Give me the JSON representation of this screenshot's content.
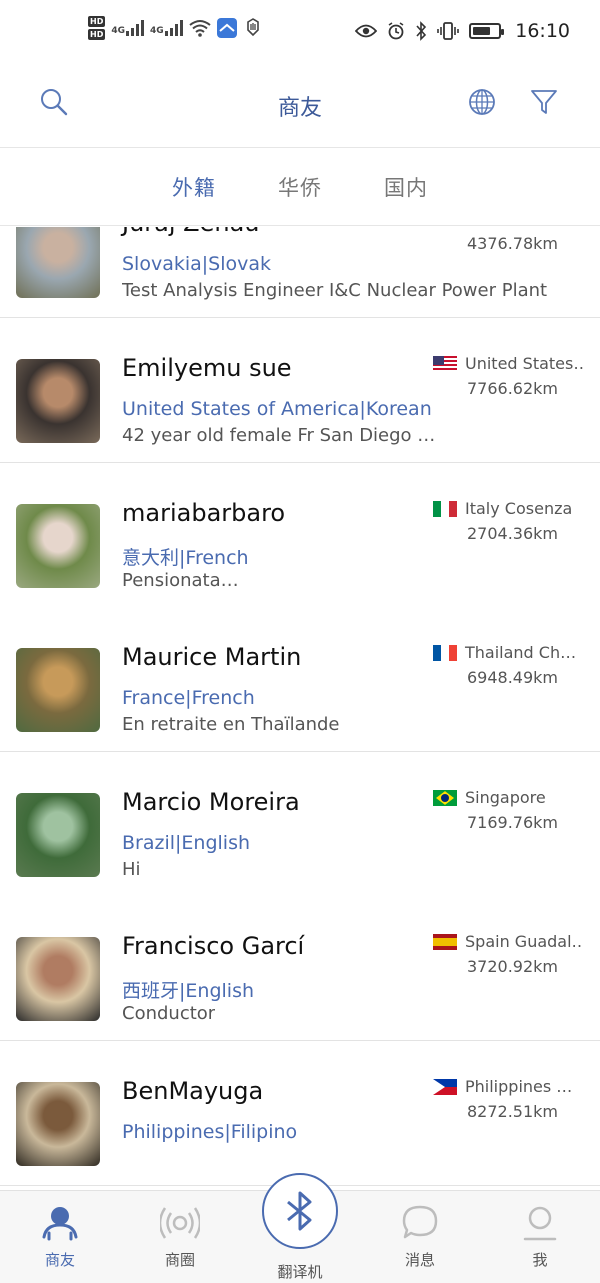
{
  "status_bar": {
    "hd1": "HD",
    "hd2": "HD",
    "net1": "4G",
    "net2": "4G",
    "time": "16:10",
    "battery_level": 0.7
  },
  "header": {
    "title": "商友",
    "search_icon": "search-icon",
    "globe_icon": "globe-icon",
    "filter_icon": "filter-icon"
  },
  "tabs": [
    {
      "label": "外籍",
      "active": true
    },
    {
      "label": "华侨",
      "active": false
    },
    {
      "label": "国内",
      "active": false
    }
  ],
  "contacts": [
    {
      "name": "Juraj Zenau",
      "origin": "Slovakia|Slovak",
      "bio": "Test Analysis Engineer I&C Nuclear Power Plant",
      "location": "",
      "distance": "4376.78km",
      "flag": "",
      "avatar_colors": [
        "#9aa7b0",
        "#c9b1a0",
        "#6f6f55"
      ]
    },
    {
      "name": "Emilyemu sue",
      "origin": "United States of America|Korean",
      "bio": " 42 year old female Fr San Diego …",
      "location": "United States…",
      "distance": "7766.62km",
      "flag": "us",
      "avatar_colors": [
        "#3a3330",
        "#b78a6a",
        "#7a6a5a"
      ]
    },
    {
      "name": "mariabarbaro",
      "origin": "意大利|French",
      "bio": "Pensionata…",
      "location": "Italy Cosenza",
      "distance": "2704.36km",
      "flag": "it",
      "avatar_colors": [
        "#6f8a4a",
        "#e6d6cc",
        "#9aa880"
      ]
    },
    {
      "name": "Maurice Martin",
      "origin": "France|French",
      "bio": "En retraite en Thaïlande",
      "location": "Thailand  Ch…",
      "distance": "6948.49km",
      "flag": "fr",
      "avatar_colors": [
        "#7b6a3f",
        "#c79a5a",
        "#4f6a40"
      ]
    },
    {
      "name": "Marcio Moreira",
      "origin": "Brazil|English",
      "bio": "Hi",
      "location": "Singapore",
      "distance": "7169.76km",
      "flag": "br",
      "avatar_colors": [
        "#3f6b3a",
        "#9fc2a0",
        "#5a7a50"
      ]
    },
    {
      "name": "Francisco Garcí",
      "origin": "西班牙|English",
      "bio": "Conductor",
      "location": "Spain Guadal…",
      "distance": "3720.92km",
      "flag": "es",
      "avatar_colors": [
        "#d9c6a4",
        "#b07c62",
        "#2a2a2a"
      ]
    },
    {
      "name": "BenMayuga",
      "origin": "Philippines|Filipino",
      "bio": "",
      "location": "Philippines  …",
      "distance": "8272.51km",
      "flag": "ph",
      "avatar_colors": [
        "#c9b89a",
        "#7b5a3c",
        "#2f2a22"
      ]
    }
  ],
  "bottom_nav": [
    {
      "label": "商友",
      "icon": "people-icon",
      "active": true
    },
    {
      "label": "商圈",
      "icon": "broadcast-icon",
      "active": false
    },
    {
      "label": "翻译机",
      "icon": "bluetooth-icon",
      "active": false
    },
    {
      "label": "消息",
      "icon": "chat-bubble-icon",
      "active": false
    },
    {
      "label": "我",
      "icon": "person-icon",
      "active": false
    }
  ]
}
